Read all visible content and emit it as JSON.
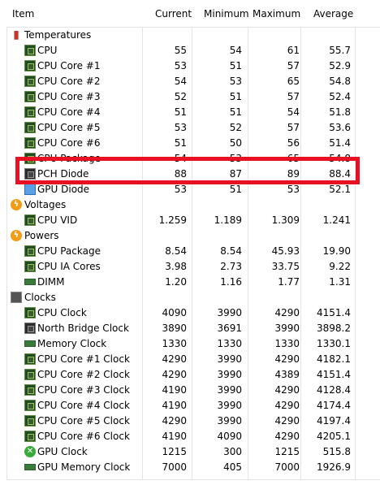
{
  "columns": {
    "item": "Item",
    "current": "Current",
    "minimum": "Minimum",
    "maximum": "Maximum",
    "average": "Average"
  },
  "groups": [
    {
      "label": "Temperatures",
      "icon": "thermometer-icon",
      "rows": [
        {
          "label": "CPU",
          "icon": "chip-icon",
          "current": "55",
          "minimum": "54",
          "maximum": "61",
          "average": "55.7"
        },
        {
          "label": "CPU Core #1",
          "icon": "chip-icon",
          "current": "53",
          "minimum": "51",
          "maximum": "57",
          "average": "52.9"
        },
        {
          "label": "CPU Core #2",
          "icon": "chip-icon",
          "current": "54",
          "minimum": "53",
          "maximum": "65",
          "average": "54.8"
        },
        {
          "label": "CPU Core #3",
          "icon": "chip-icon",
          "current": "52",
          "minimum": "51",
          "maximum": "57",
          "average": "52.4"
        },
        {
          "label": "CPU Core #4",
          "icon": "chip-icon",
          "current": "51",
          "minimum": "51",
          "maximum": "54",
          "average": "51.8"
        },
        {
          "label": "CPU Core #5",
          "icon": "chip-icon",
          "current": "53",
          "minimum": "52",
          "maximum": "57",
          "average": "53.6"
        },
        {
          "label": "CPU Core #6",
          "icon": "chip-icon",
          "current": "51",
          "minimum": "50",
          "maximum": "56",
          "average": "51.4"
        },
        {
          "label": "CPU Package",
          "icon": "chip-icon",
          "current": "54",
          "minimum": "53",
          "maximum": "65",
          "average": "54.8"
        },
        {
          "label": "PCH Diode",
          "icon": "chip-dark-icon",
          "current": "88",
          "minimum": "87",
          "maximum": "89",
          "average": "88.4"
        },
        {
          "label": "GPU Diode",
          "icon": "monitor-icon",
          "current": "53",
          "minimum": "51",
          "maximum": "53",
          "average": "52.1"
        }
      ]
    },
    {
      "label": "Voltages",
      "icon": "bolt-icon",
      "rows": [
        {
          "label": "CPU VID",
          "icon": "chip-icon",
          "current": "1.259",
          "minimum": "1.189",
          "maximum": "1.309",
          "average": "1.241"
        }
      ]
    },
    {
      "label": "Powers",
      "icon": "bolt-icon",
      "rows": [
        {
          "label": "CPU Package",
          "icon": "chip-icon",
          "current": "8.54",
          "minimum": "8.54",
          "maximum": "45.93",
          "average": "19.90"
        },
        {
          "label": "CPU IA Cores",
          "icon": "chip-icon",
          "current": "3.98",
          "minimum": "2.73",
          "maximum": "33.75",
          "average": "9.22"
        },
        {
          "label": "DIMM",
          "icon": "memory-icon",
          "current": "1.20",
          "minimum": "1.16",
          "maximum": "1.77",
          "average": "1.31"
        }
      ]
    },
    {
      "label": "Clocks",
      "icon": "clock-chip-icon",
      "rows": [
        {
          "label": "CPU Clock",
          "icon": "chip-icon",
          "current": "4090",
          "minimum": "3990",
          "maximum": "4290",
          "average": "4151.4"
        },
        {
          "label": "North Bridge Clock",
          "icon": "chip-dark-icon",
          "current": "3890",
          "minimum": "3691",
          "maximum": "3990",
          "average": "3898.2"
        },
        {
          "label": "Memory Clock",
          "icon": "memory-icon",
          "current": "1330",
          "minimum": "1330",
          "maximum": "1330",
          "average": "1330.1"
        },
        {
          "label": "CPU Core #1 Clock",
          "icon": "chip-icon",
          "current": "4290",
          "minimum": "3990",
          "maximum": "4290",
          "average": "4182.1"
        },
        {
          "label": "CPU Core #2 Clock",
          "icon": "chip-icon",
          "current": "4290",
          "minimum": "3990",
          "maximum": "4389",
          "average": "4151.4"
        },
        {
          "label": "CPU Core #3 Clock",
          "icon": "chip-icon",
          "current": "4190",
          "minimum": "3990",
          "maximum": "4290",
          "average": "4128.4"
        },
        {
          "label": "CPU Core #4 Clock",
          "icon": "chip-icon",
          "current": "4190",
          "minimum": "3990",
          "maximum": "4290",
          "average": "4174.4"
        },
        {
          "label": "CPU Core #5 Clock",
          "icon": "chip-icon",
          "current": "4290",
          "minimum": "3990",
          "maximum": "4290",
          "average": "4197.4"
        },
        {
          "label": "CPU Core #6 Clock",
          "icon": "chip-icon",
          "current": "4190",
          "minimum": "4090",
          "maximum": "4290",
          "average": "4205.1"
        },
        {
          "label": "GPU Clock",
          "icon": "xbox-icon",
          "current": "1215",
          "minimum": "300",
          "maximum": "1215",
          "average": "515.8"
        },
        {
          "label": "GPU Memory Clock",
          "icon": "memory-icon",
          "current": "7000",
          "minimum": "405",
          "maximum": "7000",
          "average": "1926.9"
        }
      ]
    }
  ],
  "highlight": {
    "color": "#e81123",
    "target": "PCH Diode"
  }
}
